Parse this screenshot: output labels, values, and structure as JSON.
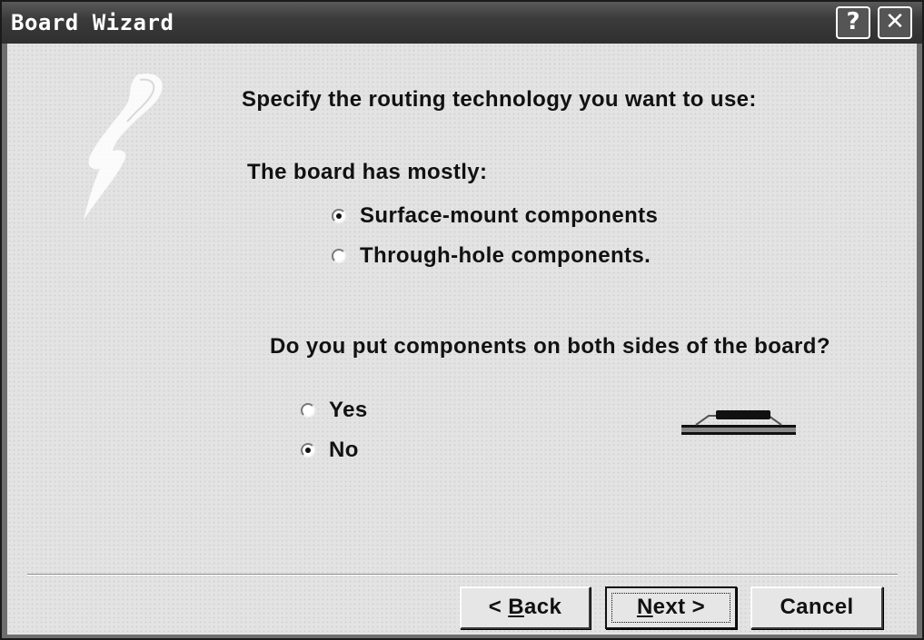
{
  "window": {
    "title": "Board Wizard",
    "help_glyph": "?",
    "close_glyph": "✕"
  },
  "logo": {
    "icon": "lightning-bolt-icon"
  },
  "heading": "Specify the routing technology you want to use:",
  "board_type": {
    "label": "The board has mostly:",
    "options": [
      {
        "label": "Surface-mount components",
        "checked": true
      },
      {
        "label": "Through-hole components.",
        "checked": false
      }
    ]
  },
  "sides": {
    "label": "Do you put components on both sides of the board?",
    "options": [
      {
        "label": "Yes",
        "checked": false
      },
      {
        "label": "No",
        "checked": true
      }
    ],
    "illustration": "single-sided-board-icon"
  },
  "buttons": {
    "back": {
      "prefix": "< ",
      "mnemonic": "B",
      "rest": "ack"
    },
    "next": {
      "mnemonic": "N",
      "rest": "ext >"
    },
    "cancel": "Cancel"
  }
}
